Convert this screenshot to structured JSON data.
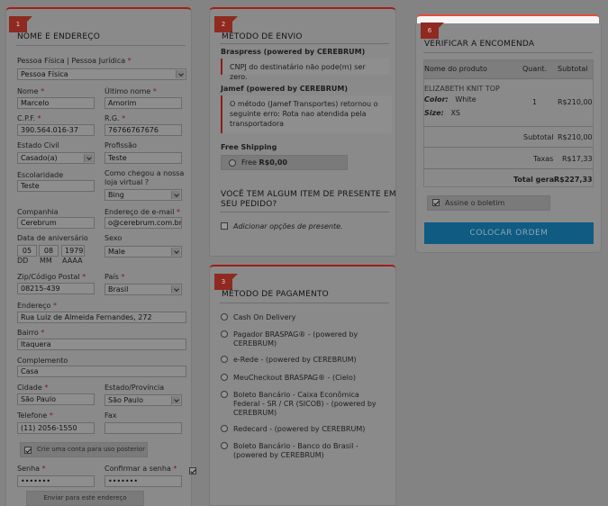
{
  "steps": [
    "1",
    "2",
    "3",
    "6"
  ],
  "address": {
    "title": "NOME E ENDEREÇO",
    "person_type": {
      "label": "Pessoa Física | Pessoa Jurídica",
      "value": "Pessoa Física"
    },
    "nome": {
      "label": "Nome",
      "value": "Marcelo"
    },
    "ultimo_nome": {
      "label": "Último nome",
      "value": "Amorim"
    },
    "cpf": {
      "label": "C.P.F.",
      "value": "390.564.016-37"
    },
    "rg": {
      "label": "R.G.",
      "value": "76766767676"
    },
    "estado_civil": {
      "label": "Estado Civil",
      "value": "Casado(a)"
    },
    "profissao": {
      "label": "Profissão",
      "value": "Teste"
    },
    "escolaridade": {
      "label": "Escolaridade",
      "value": "Teste"
    },
    "como_chegou": {
      "label1": "Como chegou a nossa",
      "label2": "loja virtual ?",
      "value": "Bing"
    },
    "companhia": {
      "label": "Companhia",
      "value": "Cerebrum"
    },
    "email": {
      "label": "Endereço de e-mail",
      "value": "o@cerebrum.com.br"
    },
    "nascimento": {
      "label": "Data de aniversário",
      "dd": "05",
      "mm": "08",
      "aaaa": "1979",
      "dd_lbl": "DD",
      "mm_lbl": "MM",
      "aaaa_lbl": "AAAA"
    },
    "sexo": {
      "label": "Sexo",
      "value": "Male"
    },
    "cep": {
      "label": "Zip/Código Postal",
      "value": "08215-439"
    },
    "pais": {
      "label": "País",
      "value": "Brasil"
    },
    "endereco": {
      "label": "Endereço",
      "value": "Rua Luiz de Almeida Fernandes, 272"
    },
    "bairro": {
      "label": "Bairro",
      "value": "Itaquera"
    },
    "complemento": {
      "label": "Complemento",
      "value": "Casa"
    },
    "cidade": {
      "label": "Cidade",
      "value": "São Paulo"
    },
    "estado": {
      "label": "Estado/Província",
      "value": "São Paulo"
    },
    "telefone": {
      "label": "Telefone",
      "value": "(11) 2056-1550"
    },
    "fax": {
      "label": "Fax",
      "value": ""
    },
    "create_account": "Crie uma conta para uso posterior",
    "senha": {
      "label": "Senha",
      "value": "•••••••"
    },
    "confirmar_senha": {
      "label": "Confirmar a senha",
      "value": "•••••••"
    },
    "ship_here_btn": "Enviar para este endereço"
  },
  "shipping": {
    "title": "MÉTODO DE ENVIO",
    "carrier1": "Braspress (powered by CEREBRUM)",
    "carrier1_msg": "CNPJ do destinatário não pode(m) ser zero.",
    "carrier2": "Jamef (powered by CEREBRUM)",
    "carrier2_msg": [
      "O método (Jamef Transportes) retornou o",
      "seguinte erro: Rota nao atendida pela",
      "transportadora"
    ],
    "free_title": "Free Shipping",
    "free_label": "Free",
    "free_price": "R$0,00",
    "gift_title": [
      "VOCÊ TEM ALGUM ITEM DE PRESENTE EM",
      "SEU PEDIDO?"
    ],
    "gift_option": "Adicionar opções de presente."
  },
  "payment": {
    "title": "MÉTODO DE PAGAMENTO",
    "options": [
      [
        "Cash On Delivery"
      ],
      [
        "Pagador BRASPAG® - (powered by",
        "CEREBRUM)"
      ],
      [
        "e-Rede - (powered by CEREBRUM)"
      ],
      [
        "MeuCheckout BRASPAG® - (Cielo)"
      ],
      [
        "Boleto Bancário - Caixa Econômica",
        "Federal - SR / CR (SICOB) - (powered by",
        "CEREBRUM)"
      ],
      [
        "Redecard - (powered by CEREBRUM)"
      ],
      [
        "Boleto Bancário - Banco do Brasil -",
        "(powered by CEREBRUM)"
      ]
    ]
  },
  "review": {
    "title": "VERIFICAR A ENCOMENDA",
    "col_product": "Nome do produto",
    "col_qty": "Quant.",
    "col_subtotal": "Subtotal",
    "product_name": "ELIZABETH KNIT TOP",
    "color_label": "Color:",
    "color_value": "White",
    "size_label": "Size:",
    "size_value": "XS",
    "qty": "1",
    "line_total": "R$210,00",
    "subtotal_label": "Subtotal",
    "subtotal_value": "R$210,00",
    "tax_label": "Taxas",
    "tax_value": "R$17,33",
    "grand_label": "Total geral",
    "grand_value": "R$227,33",
    "newsletter": "Assine o boletim",
    "place_order": "COLOCAR ORDEM"
  },
  "colors": {
    "overlay": "#838383",
    "accent_red": "#a01f16",
    "button_blue": "#0f5b82"
  }
}
